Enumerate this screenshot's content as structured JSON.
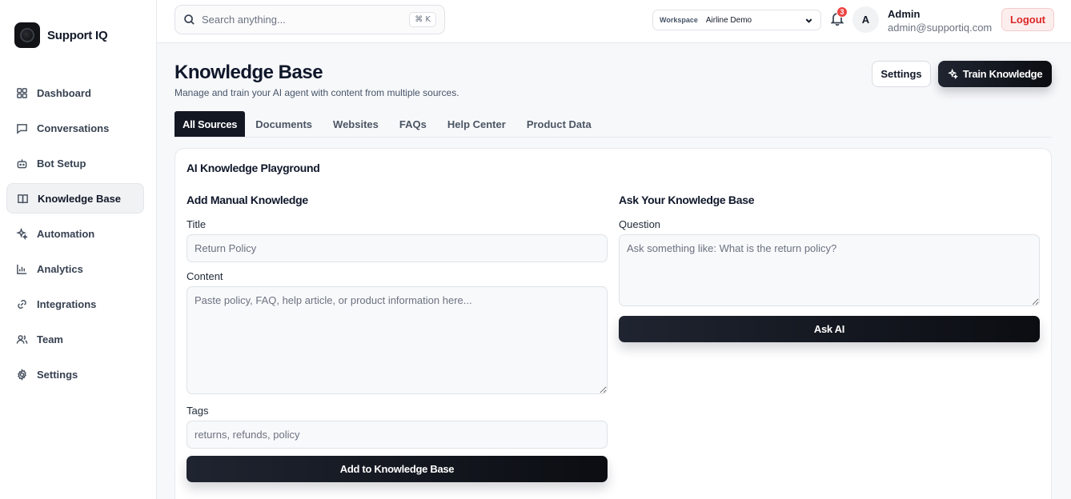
{
  "brand": {
    "name": "Support IQ"
  },
  "sidebar": {
    "items": [
      {
        "label": "Dashboard",
        "icon": "grid-icon"
      },
      {
        "label": "Conversations",
        "icon": "chat-icon"
      },
      {
        "label": "Bot Setup",
        "icon": "bot-icon"
      },
      {
        "label": "Knowledge Base",
        "icon": "book-icon",
        "active": true
      },
      {
        "label": "Automation",
        "icon": "sparkles-icon"
      },
      {
        "label": "Analytics",
        "icon": "bar-chart-icon"
      },
      {
        "label": "Integrations",
        "icon": "link-icon"
      },
      {
        "label": "Team",
        "icon": "users-icon"
      },
      {
        "label": "Settings",
        "icon": "gear-icon"
      }
    ]
  },
  "topbar": {
    "search_placeholder": "Search anything...",
    "shortcut": "⌘ K",
    "workspace_label": "Workspace",
    "workspace_value": "Airline Demo",
    "notification_count": "3",
    "avatar_initial": "A",
    "user_name": "Admin",
    "user_email": "admin@supportiq.com",
    "logout_label": "Logout"
  },
  "header": {
    "title": "Knowledge Base",
    "subtitle": "Manage and train your AI agent with content from multiple sources.",
    "settings_label": "Settings",
    "train_label": "Train Knowledge"
  },
  "tabs": [
    {
      "label": "All Sources",
      "active": true
    },
    {
      "label": "Documents"
    },
    {
      "label": "Websites"
    },
    {
      "label": "FAQs"
    },
    {
      "label": "Help Center"
    },
    {
      "label": "Product Data"
    }
  ],
  "playground": {
    "title": "AI Knowledge Playground",
    "manual": {
      "title": "Add Manual Knowledge",
      "title_label": "Title",
      "title_placeholder": "Return Policy",
      "content_label": "Content",
      "content_placeholder": "Paste policy, FAQ, help article, or product information here...",
      "tags_label": "Tags",
      "tags_placeholder": "returns, refunds, policy",
      "submit_label": "Add to Knowledge Base"
    },
    "ask": {
      "title": "Ask Your Knowledge Base",
      "question_label": "Question",
      "question_placeholder": "Ask something like: What is the return policy?",
      "submit_label": "Ask AI"
    }
  }
}
